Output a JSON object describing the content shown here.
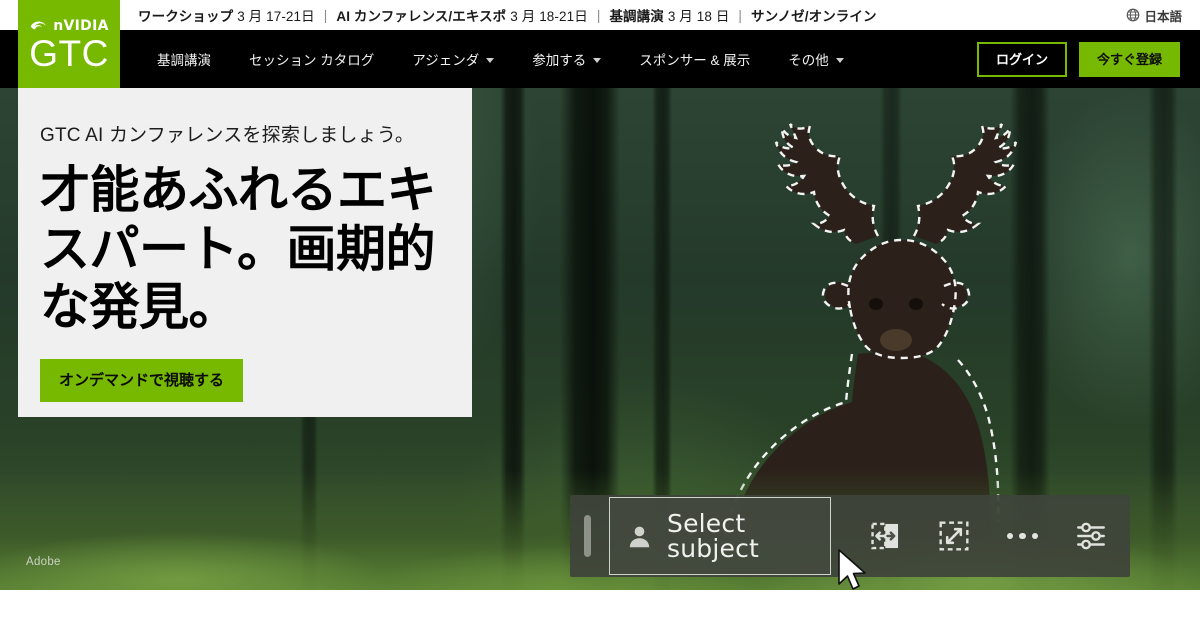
{
  "topbar": {
    "dates": [
      {
        "label": "ワークショップ",
        "value": "3 月 17-21日"
      },
      {
        "label": "AI カンファレンス/エキスポ",
        "value": "3 月 18-21日"
      },
      {
        "label": "基調講演",
        "value": "3 月 18 日"
      },
      {
        "label": "サンノゼ/オンライン",
        "value": ""
      }
    ],
    "separator": "|",
    "language": "日本語",
    "language_icon": "globe-icon"
  },
  "logo": {
    "brand": "nVIDIA",
    "product": "GTC",
    "brand_icon": "nvidia-eye-icon",
    "background": "#76b900"
  },
  "nav": {
    "items": [
      {
        "label": "基調講演",
        "has_caret": false
      },
      {
        "label": "セッション カタログ",
        "has_caret": false
      },
      {
        "label": "アジェンダ",
        "has_caret": true
      },
      {
        "label": "参加する",
        "has_caret": true
      },
      {
        "label": "スポンサー & 展示",
        "has_caret": false
      },
      {
        "label": "その他",
        "has_caret": true
      }
    ],
    "login_label": "ログイン",
    "register_label": "今すぐ登録"
  },
  "hero": {
    "subtitle": "GTC AI カンファレンスを探索しましょう。",
    "title": "才能あふれるエキスパート。画期的な発見。",
    "cta_label": "オンデマンドで視聴する",
    "watermark": "Adobe",
    "accent_color": "#76b900",
    "card_background": "#f0f0f0"
  },
  "photoshop_bar": {
    "grip": "drag-handle",
    "select_subject_label": "Select subject",
    "select_subject_icon": "person-icon",
    "tools": [
      {
        "name": "invert-selection-icon"
      },
      {
        "name": "transform-selection-icon"
      },
      {
        "name": "more-options-icon"
      },
      {
        "name": "settings-sliders-icon"
      }
    ],
    "bar_color": "#3e443a"
  },
  "cursor": {
    "name": "mouse-pointer"
  }
}
